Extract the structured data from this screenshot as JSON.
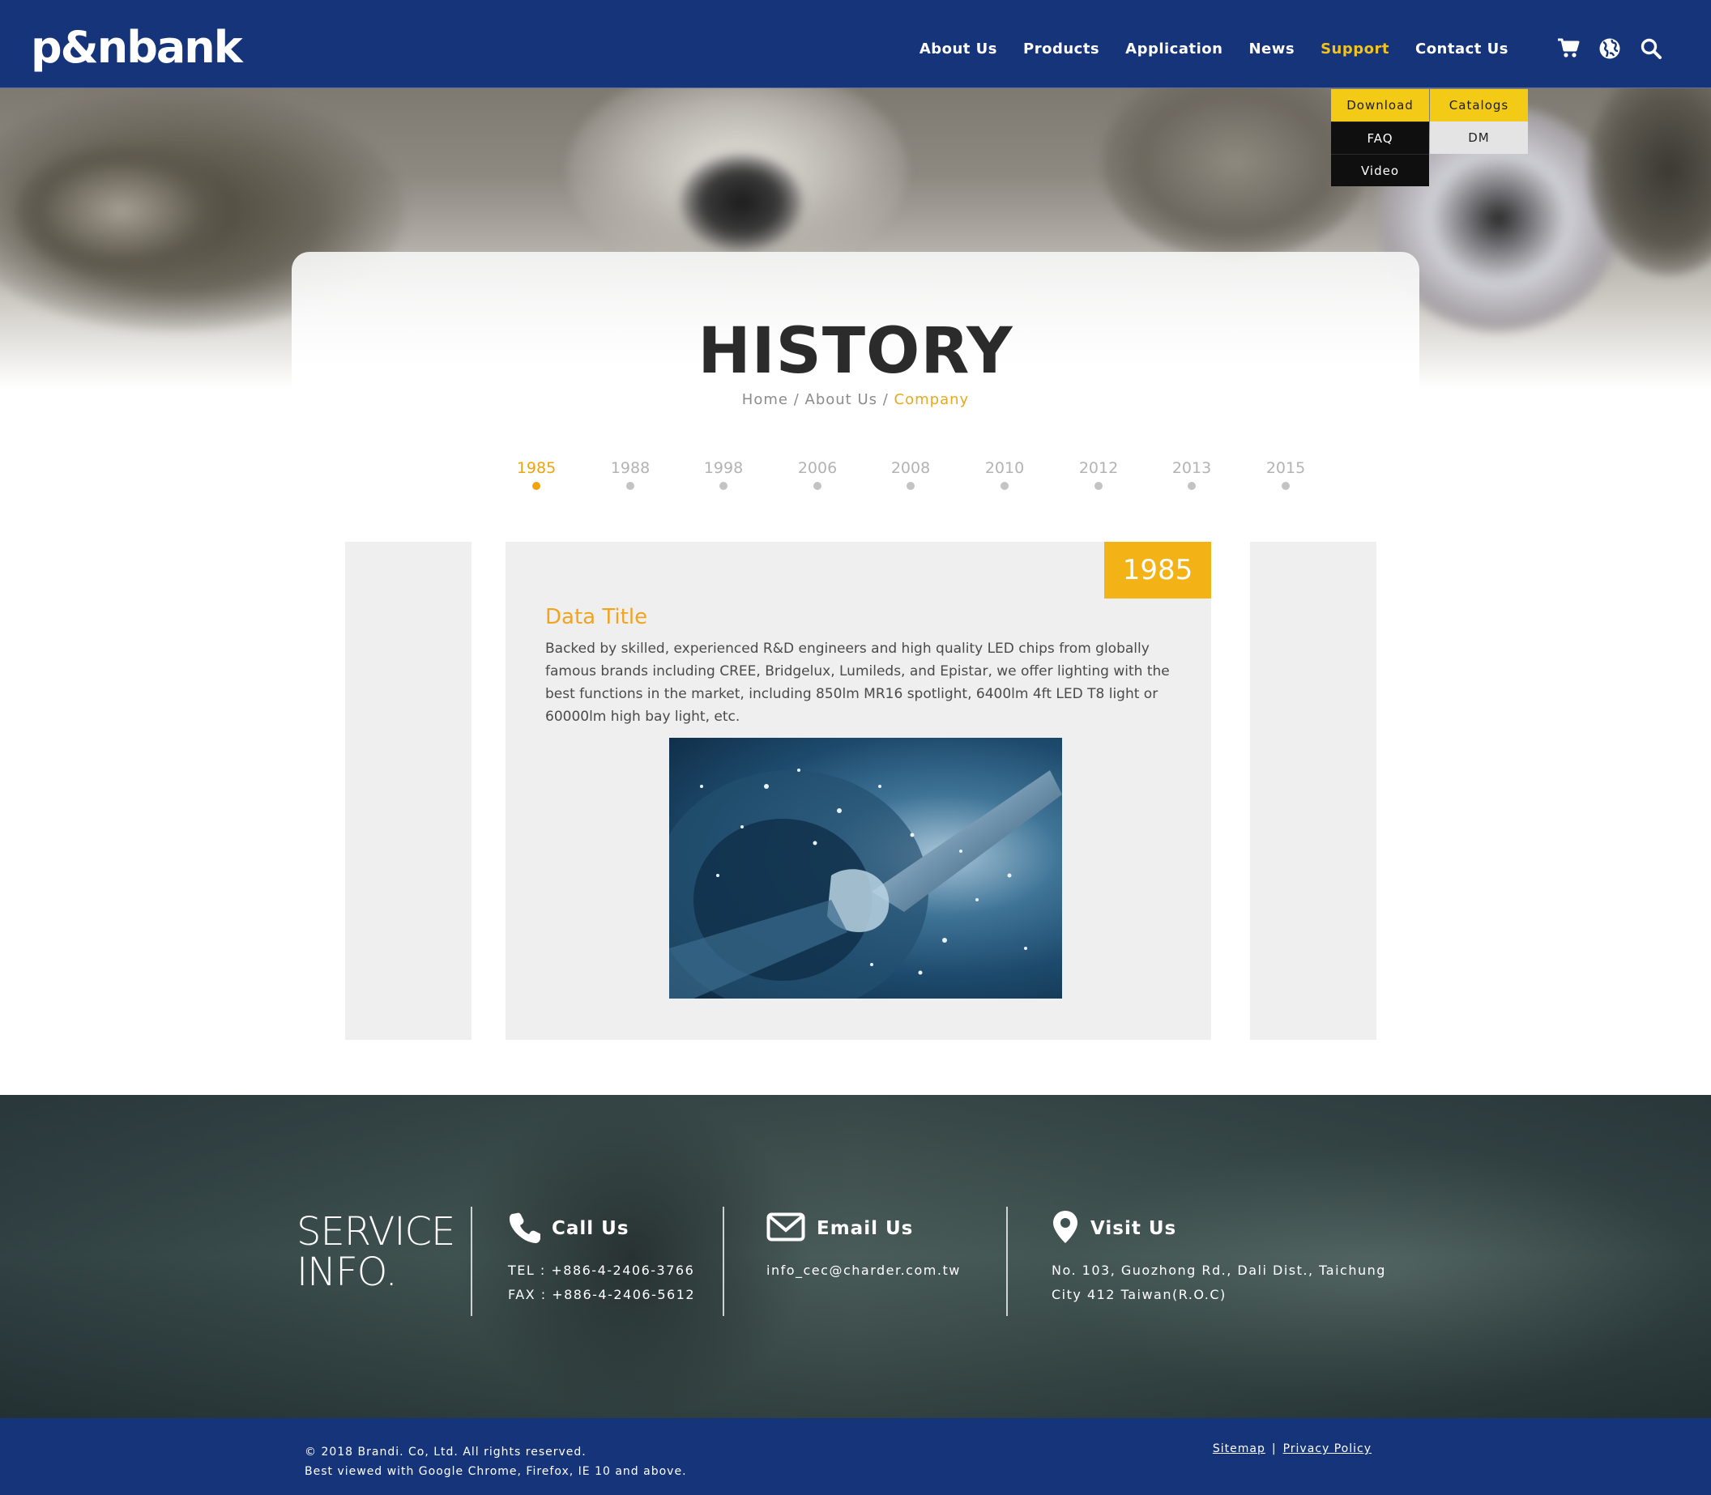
{
  "header": {
    "logo_text": "p&nbank",
    "nav": [
      "About Us",
      "Products",
      "Application",
      "News",
      "Support",
      "Contact Us"
    ],
    "active_nav": "Support",
    "icons": [
      "cart-icon",
      "globe-icon",
      "search-icon"
    ]
  },
  "support_menu": {
    "download": "Download",
    "catalogs": "Catalogs",
    "faq": "FAQ",
    "dm": "DM",
    "video": "Video"
  },
  "page": {
    "title": "HISTORY",
    "breadcrumb": {
      "home": "Home",
      "sep": "/",
      "about": "About Us",
      "current": "Company"
    }
  },
  "timeline": {
    "years": [
      "1985",
      "1988",
      "1998",
      "2006",
      "2008",
      "2010",
      "2012",
      "2013",
      "2015"
    ],
    "active": "1985"
  },
  "entry": {
    "year": "1985",
    "title": "Data Title",
    "text": "Backed by skilled, experienced R&D engineers and high quality LED chips from globally famous brands including CREE, Bridgelux, Lumileds, and Epistar, we offer lighting with the best functions in the market, including 850lm MR16 spotlight, 6400lm 4ft LED T8 light or 60000lm high bay light, etc."
  },
  "service": {
    "heading_line1": "SERVICE",
    "heading_line2": "INFO.",
    "call": {
      "title": "Call Us",
      "tel": "TEL : +886-4-2406-3766",
      "fax": "FAX : +886-4-2406-5612"
    },
    "email": {
      "title": "Email Us",
      "address": "info_cec@charder.com.tw"
    },
    "visit": {
      "title": "Visit Us",
      "line1": "No. 103, Guozhong Rd., Dali Dist., Taichung",
      "line2": "City 412 Taiwan(R.O.C)"
    }
  },
  "footer": {
    "copyright": "© 2018 Brandi. Co, Ltd. All rights reserved.",
    "browser_note": "Best viewed with Google Chrome, Firefox, IE 10 and above.",
    "sitemap": "Sitemap",
    "separator": "|",
    "privacy": "Privacy Policy"
  },
  "colors": {
    "brand_blue": "#15347a",
    "accent_yellow": "#f3c31b",
    "accent_orange": "#f0a30a"
  }
}
